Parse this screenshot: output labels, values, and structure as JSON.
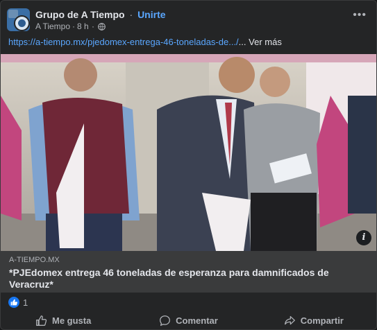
{
  "post": {
    "group_name": "Grupo de A Tiempo",
    "separator": "·",
    "join_label": "Unirte",
    "author": "A Tiempo",
    "time": "8 h",
    "meta_separator": "·",
    "more_icon": "more-dots-icon",
    "link_text": "https://a-tiempo.mx/pjedomex-entrega-46-toneladas-de.../",
    "ellipsis": "...",
    "see_more_label": "Ver más"
  },
  "preview": {
    "domain": "A-TIEMPO.MX",
    "title": "*PJEdomex entrega 46 toneladas de esperanza para damnificados de Veracruz*",
    "info_label": "i"
  },
  "reactions": {
    "icon": "like-icon",
    "count": "1"
  },
  "actions": {
    "like_label": "Me gusta",
    "comment_label": "Comentar",
    "share_label": "Compartir"
  },
  "colors": {
    "background": "#242526",
    "link": "#5aa7ff",
    "preview_bg": "#3a3b3c",
    "like_blue": "#1877f2",
    "flag_magenta": "#c2467e"
  }
}
